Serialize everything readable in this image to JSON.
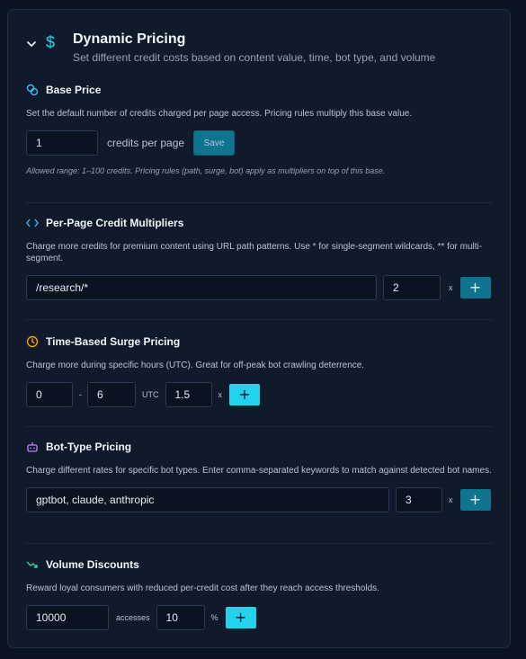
{
  "header": {
    "title": "Dynamic Pricing",
    "subtitle": "Set different credit costs based on content value, time, bot type, and volume"
  },
  "base_price": {
    "title": "Base Price",
    "description": "Set the default number of credits charged per page access. Pricing rules multiply this base value.",
    "value": "1",
    "unit_label": "credits per page",
    "save_label": "Save",
    "note": "Allowed range: 1–100 credits. Pricing rules (path, surge, bot) apply as multipliers on top of this base."
  },
  "per_page": {
    "title": "Per-Page Credit Multipliers",
    "description": "Charge more credits for premium content using URL path patterns. Use * for single-segment wildcards, ** for multi-segment.",
    "path_value": "/research/*",
    "multiplier_value": "2",
    "x_label": "x",
    "add_label": "+"
  },
  "surge": {
    "title": "Time-Based Surge Pricing",
    "description": "Charge more during specific hours (UTC). Great for off-peak bot crawling deterrence.",
    "start_value": "0",
    "dash": "-",
    "end_value": "6",
    "utc_label": "UTC",
    "multiplier_value": "1.5",
    "x_label": "x",
    "add_label": "+"
  },
  "bot_type": {
    "title": "Bot-Type Pricing",
    "description": "Charge different rates for specific bot types. Enter comma-separated keywords to match against detected bot names.",
    "keywords_value": "gptbot, claude, anthropic",
    "multiplier_value": "3",
    "x_label": "x",
    "add_label": "+"
  },
  "volume": {
    "title": "Volume Discounts",
    "description": "Reward loyal consumers with reduced per-credit cost after they reach access thresholds.",
    "accesses_value": "10000",
    "accesses_label": "accesses",
    "percent_value": "10",
    "percent_label": "%",
    "add_label": "+"
  },
  "colors": {
    "accent": "#22d3ee",
    "button_dark": "#0e7490",
    "base_icon": "#38bdf8",
    "clock_icon": "#f59e0b",
    "bot_icon": "#c084fc",
    "volume_icon": "#34d399"
  },
  "icons": {
    "collapse": "chevron-down-icon",
    "pricing": "dollar-icon",
    "base_price": "coins-icon",
    "per_page": "code-icon",
    "surge": "clock-icon",
    "bot_type": "bot-icon",
    "volume": "trending-down-icon"
  }
}
